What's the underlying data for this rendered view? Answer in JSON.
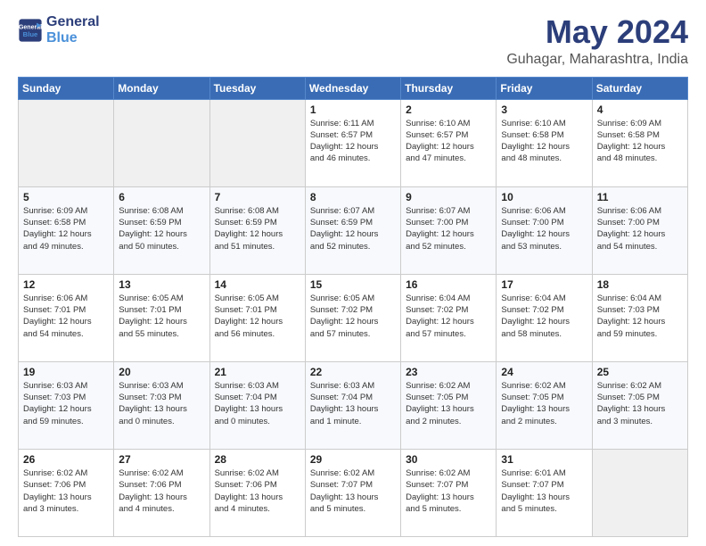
{
  "logo": {
    "text_general": "General",
    "text_blue": "Blue"
  },
  "title": "May 2024",
  "subtitle": "Guhagar, Maharashtra, India",
  "weekdays": [
    "Sunday",
    "Monday",
    "Tuesday",
    "Wednesday",
    "Thursday",
    "Friday",
    "Saturday"
  ],
  "weeks": [
    [
      {
        "day": "",
        "info": ""
      },
      {
        "day": "",
        "info": ""
      },
      {
        "day": "",
        "info": ""
      },
      {
        "day": "1",
        "info": "Sunrise: 6:11 AM\nSunset: 6:57 PM\nDaylight: 12 hours\nand 46 minutes."
      },
      {
        "day": "2",
        "info": "Sunrise: 6:10 AM\nSunset: 6:57 PM\nDaylight: 12 hours\nand 47 minutes."
      },
      {
        "day": "3",
        "info": "Sunrise: 6:10 AM\nSunset: 6:58 PM\nDaylight: 12 hours\nand 48 minutes."
      },
      {
        "day": "4",
        "info": "Sunrise: 6:09 AM\nSunset: 6:58 PM\nDaylight: 12 hours\nand 48 minutes."
      }
    ],
    [
      {
        "day": "5",
        "info": "Sunrise: 6:09 AM\nSunset: 6:58 PM\nDaylight: 12 hours\nand 49 minutes."
      },
      {
        "day": "6",
        "info": "Sunrise: 6:08 AM\nSunset: 6:59 PM\nDaylight: 12 hours\nand 50 minutes."
      },
      {
        "day": "7",
        "info": "Sunrise: 6:08 AM\nSunset: 6:59 PM\nDaylight: 12 hours\nand 51 minutes."
      },
      {
        "day": "8",
        "info": "Sunrise: 6:07 AM\nSunset: 6:59 PM\nDaylight: 12 hours\nand 52 minutes."
      },
      {
        "day": "9",
        "info": "Sunrise: 6:07 AM\nSunset: 7:00 PM\nDaylight: 12 hours\nand 52 minutes."
      },
      {
        "day": "10",
        "info": "Sunrise: 6:06 AM\nSunset: 7:00 PM\nDaylight: 12 hours\nand 53 minutes."
      },
      {
        "day": "11",
        "info": "Sunrise: 6:06 AM\nSunset: 7:00 PM\nDaylight: 12 hours\nand 54 minutes."
      }
    ],
    [
      {
        "day": "12",
        "info": "Sunrise: 6:06 AM\nSunset: 7:01 PM\nDaylight: 12 hours\nand 54 minutes."
      },
      {
        "day": "13",
        "info": "Sunrise: 6:05 AM\nSunset: 7:01 PM\nDaylight: 12 hours\nand 55 minutes."
      },
      {
        "day": "14",
        "info": "Sunrise: 6:05 AM\nSunset: 7:01 PM\nDaylight: 12 hours\nand 56 minutes."
      },
      {
        "day": "15",
        "info": "Sunrise: 6:05 AM\nSunset: 7:02 PM\nDaylight: 12 hours\nand 57 minutes."
      },
      {
        "day": "16",
        "info": "Sunrise: 6:04 AM\nSunset: 7:02 PM\nDaylight: 12 hours\nand 57 minutes."
      },
      {
        "day": "17",
        "info": "Sunrise: 6:04 AM\nSunset: 7:02 PM\nDaylight: 12 hours\nand 58 minutes."
      },
      {
        "day": "18",
        "info": "Sunrise: 6:04 AM\nSunset: 7:03 PM\nDaylight: 12 hours\nand 59 minutes."
      }
    ],
    [
      {
        "day": "19",
        "info": "Sunrise: 6:03 AM\nSunset: 7:03 PM\nDaylight: 12 hours\nand 59 minutes."
      },
      {
        "day": "20",
        "info": "Sunrise: 6:03 AM\nSunset: 7:03 PM\nDaylight: 13 hours\nand 0 minutes."
      },
      {
        "day": "21",
        "info": "Sunrise: 6:03 AM\nSunset: 7:04 PM\nDaylight: 13 hours\nand 0 minutes."
      },
      {
        "day": "22",
        "info": "Sunrise: 6:03 AM\nSunset: 7:04 PM\nDaylight: 13 hours\nand 1 minute."
      },
      {
        "day": "23",
        "info": "Sunrise: 6:02 AM\nSunset: 7:05 PM\nDaylight: 13 hours\nand 2 minutes."
      },
      {
        "day": "24",
        "info": "Sunrise: 6:02 AM\nSunset: 7:05 PM\nDaylight: 13 hours\nand 2 minutes."
      },
      {
        "day": "25",
        "info": "Sunrise: 6:02 AM\nSunset: 7:05 PM\nDaylight: 13 hours\nand 3 minutes."
      }
    ],
    [
      {
        "day": "26",
        "info": "Sunrise: 6:02 AM\nSunset: 7:06 PM\nDaylight: 13 hours\nand 3 minutes."
      },
      {
        "day": "27",
        "info": "Sunrise: 6:02 AM\nSunset: 7:06 PM\nDaylight: 13 hours\nand 4 minutes."
      },
      {
        "day": "28",
        "info": "Sunrise: 6:02 AM\nSunset: 7:06 PM\nDaylight: 13 hours\nand 4 minutes."
      },
      {
        "day": "29",
        "info": "Sunrise: 6:02 AM\nSunset: 7:07 PM\nDaylight: 13 hours\nand 5 minutes."
      },
      {
        "day": "30",
        "info": "Sunrise: 6:02 AM\nSunset: 7:07 PM\nDaylight: 13 hours\nand 5 minutes."
      },
      {
        "day": "31",
        "info": "Sunrise: 6:01 AM\nSunset: 7:07 PM\nDaylight: 13 hours\nand 5 minutes."
      },
      {
        "day": "",
        "info": ""
      }
    ]
  ]
}
